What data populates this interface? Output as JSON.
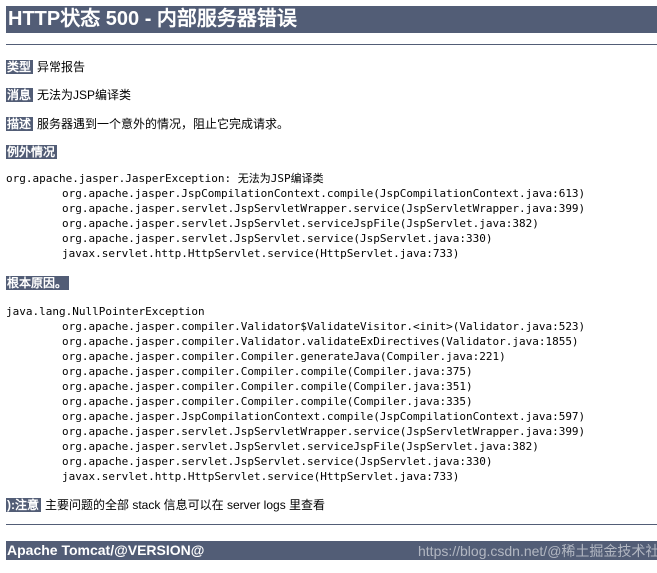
{
  "title": "HTTP状态 500 - 内部服务器错误",
  "type": {
    "label": "类型",
    "value": "异常报告"
  },
  "message": {
    "label": "消息",
    "value": "无法为JSP编译类"
  },
  "description": {
    "label": "描述",
    "value": "服务器遇到一个意外的情况，阻止它完成请求。"
  },
  "exception": {
    "heading": "例外情况",
    "first_line": "org.apache.jasper.JasperException: 无法为JSP编译类",
    "frames": [
      "org.apache.jasper.JspCompilationContext.compile(JspCompilationContext.java:613)",
      "org.apache.jasper.servlet.JspServletWrapper.service(JspServletWrapper.java:399)",
      "org.apache.jasper.servlet.JspServlet.serviceJspFile(JspServlet.java:382)",
      "org.apache.jasper.servlet.JspServlet.service(JspServlet.java:330)",
      "javax.servlet.http.HttpServlet.service(HttpServlet.java:733)"
    ]
  },
  "root_cause": {
    "heading": "根本原因。",
    "first_line": "java.lang.NullPointerException",
    "frames": [
      "org.apache.jasper.compiler.Validator$ValidateVisitor.<init>(Validator.java:523)",
      "org.apache.jasper.compiler.Validator.validateExDirectives(Validator.java:1855)",
      "org.apache.jasper.compiler.Compiler.generateJava(Compiler.java:221)",
      "org.apache.jasper.compiler.Compiler.compile(Compiler.java:375)",
      "org.apache.jasper.compiler.Compiler.compile(Compiler.java:351)",
      "org.apache.jasper.compiler.Compiler.compile(Compiler.java:335)",
      "org.apache.jasper.JspCompilationContext.compile(JspCompilationContext.java:597)",
      "org.apache.jasper.servlet.JspServletWrapper.service(JspServletWrapper.java:399)",
      "org.apache.jasper.servlet.JspServlet.serviceJspFile(JspServlet.java:382)",
      "org.apache.jasper.servlet.JspServlet.service(JspServlet.java:330)",
      "javax.servlet.http.HttpServlet.service(HttpServlet.java:733)"
    ]
  },
  "note": {
    "label": "):注意",
    "value": "主要问题的全部 stack 信息可以在 server logs 里查看"
  },
  "footer": "Apache Tomcat/@VERSION@",
  "watermark": "https://blog.csdn.net/@稀土掘金技术社区",
  "colors": {
    "accent": "#525d76",
    "background": "#ffffff",
    "text": "#000000"
  }
}
